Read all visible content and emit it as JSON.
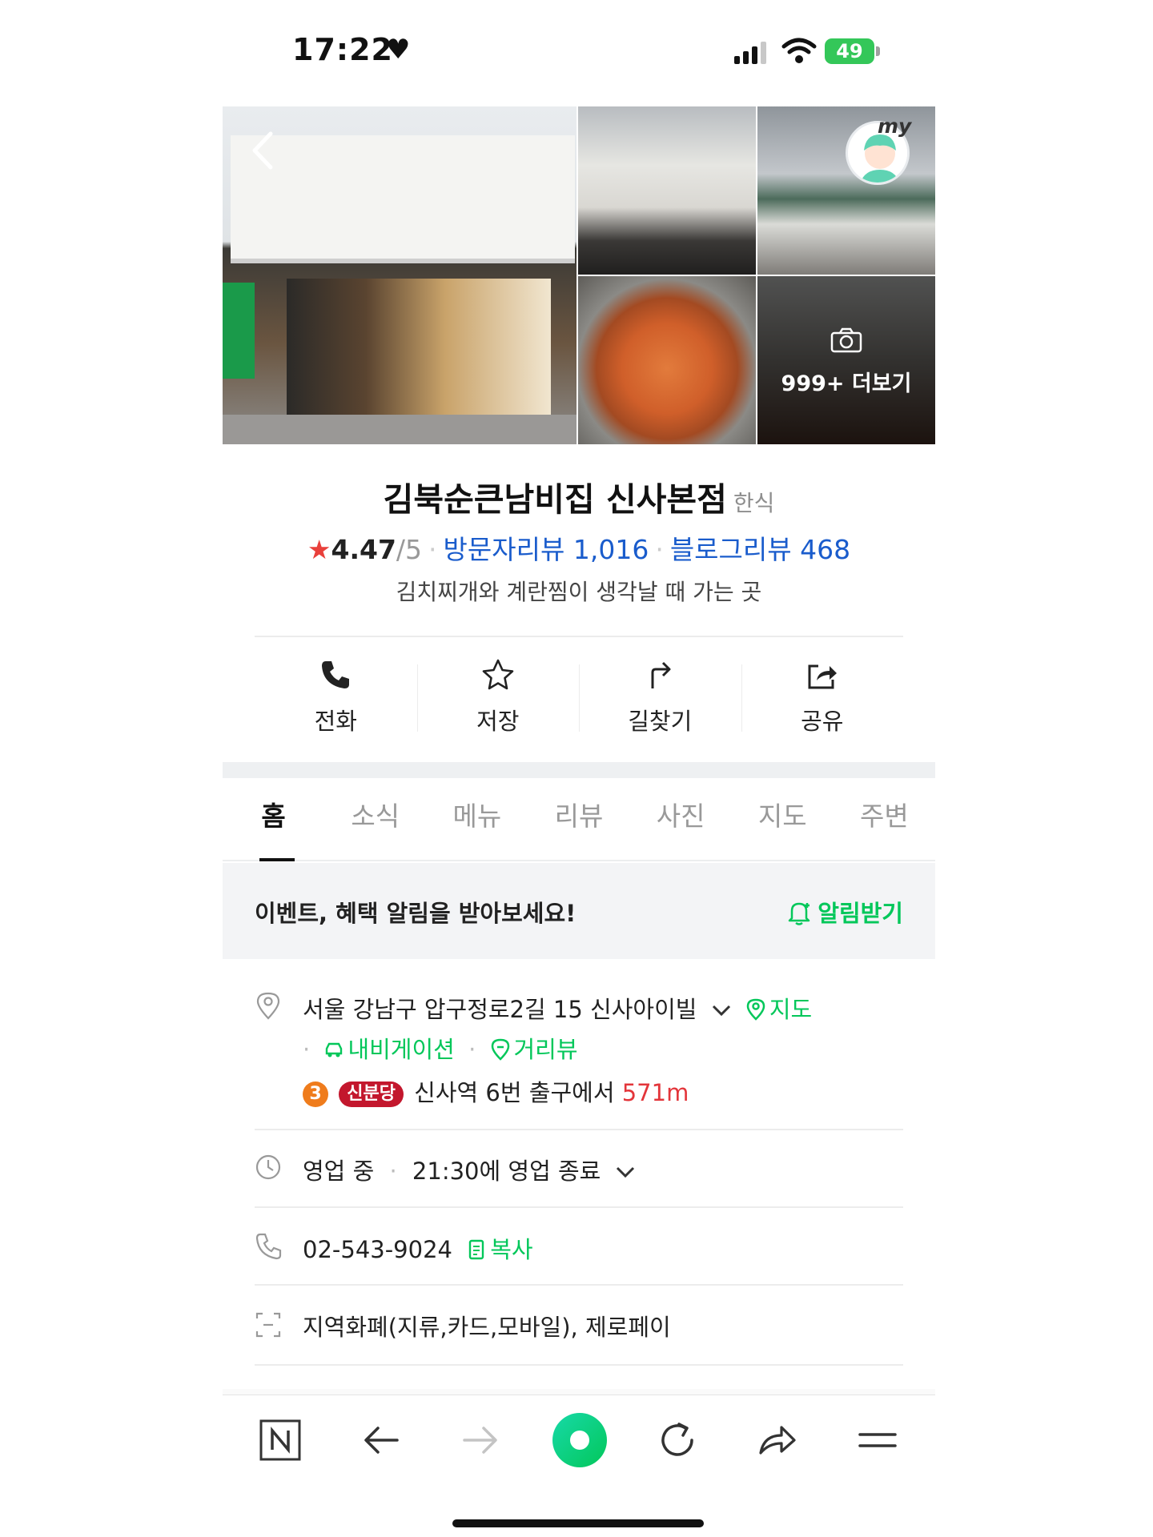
{
  "status_bar": {
    "time": "17:22",
    "battery": "49"
  },
  "photos": {
    "more_label": "999+ 더보기",
    "my_label": "my"
  },
  "place": {
    "name": "김북순큰남비집 신사본점",
    "category": "한식",
    "rating": "4.47",
    "rating_max": "/5",
    "visitor_reviews": "방문자리뷰 1,016",
    "blog_reviews": "블로그리뷰 468",
    "description": "김치찌개와 계란찜이 생각날 때 가는 곳"
  },
  "actions": [
    {
      "label": "전화",
      "icon": "phone-icon"
    },
    {
      "label": "저장",
      "icon": "star-icon"
    },
    {
      "label": "길찾기",
      "icon": "directions-icon"
    },
    {
      "label": "공유",
      "icon": "share-icon"
    }
  ],
  "tabs": [
    "홈",
    "소식",
    "메뉴",
    "리뷰",
    "사진",
    "지도",
    "주변"
  ],
  "notice": {
    "text": "이벤트, 혜택 알림을 받아보세요!",
    "button": "알림받기"
  },
  "info": {
    "address": "서울 강남구 압구정로2길 15 신사아이빌",
    "map_link": "지도",
    "navigation_link": "내비게이션",
    "streetview_link": "거리뷰",
    "subway_line_num": "3",
    "subway_line_name": "신분당",
    "subway_text": "신사역 6번 출구에서",
    "subway_distance": "571m",
    "hours_status": "영업 중",
    "hours_detail": "21:30에 영업 종료",
    "phone": "02-543-9024",
    "copy_label": "복사",
    "payment": "지역화폐(지류,카드,모바일), 제로페이"
  },
  "colors": {
    "accent_green": "#03c75a",
    "link_blue": "#1a5ccc",
    "star_red": "#e9403b",
    "distance_red": "#e3353a"
  }
}
